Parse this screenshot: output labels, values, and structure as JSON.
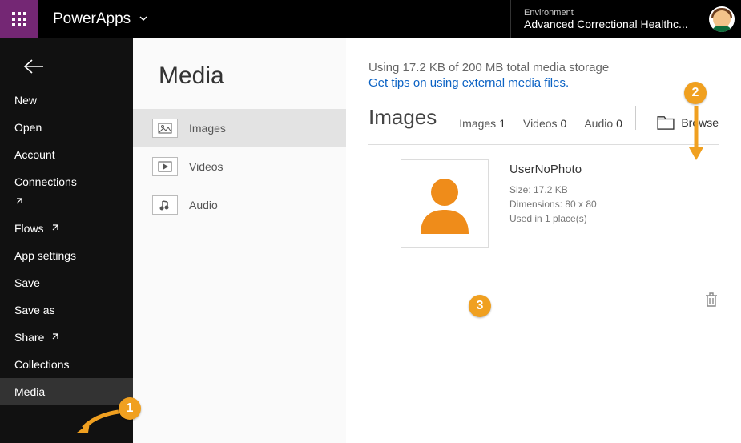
{
  "topbar": {
    "brand": "PowerApps",
    "env_label": "Environment",
    "env_name": "Advanced Correctional Healthc..."
  },
  "sidebar": {
    "items": [
      {
        "label": "New",
        "ext": false
      },
      {
        "label": "Open",
        "ext": false
      },
      {
        "label": "Account",
        "ext": false
      },
      {
        "label": "Connections",
        "ext": true,
        "extBelow": true
      },
      {
        "label": "Flows",
        "ext": true
      },
      {
        "label": "App settings",
        "ext": false
      },
      {
        "label": "Save",
        "ext": false
      },
      {
        "label": "Save as",
        "ext": false
      },
      {
        "label": "Share",
        "ext": true
      },
      {
        "label": "Collections",
        "ext": false
      },
      {
        "label": "Media",
        "ext": false,
        "active": true
      }
    ]
  },
  "middle": {
    "title": "Media",
    "tabs": [
      {
        "label": "Images",
        "icon": "image-icon",
        "active": true
      },
      {
        "label": "Videos",
        "icon": "video-icon"
      },
      {
        "label": "Audio",
        "icon": "audio-icon"
      }
    ]
  },
  "content": {
    "storage_line": "Using 17.2 KB of 200 MB total media storage",
    "tips_link": "Get tips on using external media files.",
    "section_title": "Images",
    "counts": {
      "images_label": "Images",
      "images_value": "1",
      "videos_label": "Videos",
      "videos_value": "0",
      "audio_label": "Audio",
      "audio_value": "0"
    },
    "browse_label": "Browse",
    "item": {
      "name": "UserNoPhoto",
      "size_line": "Size: 17.2 KB",
      "dim_line": "Dimensions: 80 x 80",
      "usage_line": "Used in 1 place(s)"
    }
  },
  "annotations": {
    "b1": "1",
    "b2": "2",
    "b3": "3"
  }
}
